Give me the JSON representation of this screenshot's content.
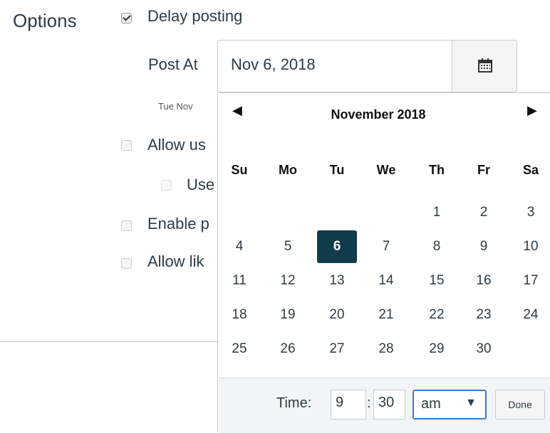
{
  "options": {
    "label": "Options",
    "delay_posting": {
      "label": "Delay posting",
      "checked": true
    },
    "post_at_label": "Post At",
    "post_at_value": "Nov 6, 2018",
    "post_at_hint": "Tue Nov",
    "allow_users": {
      "label": "Allow us",
      "checked": false
    },
    "users_sub": {
      "label": "Use",
      "checked": false
    },
    "enable": {
      "label": "Enable p",
      "checked": false
    },
    "allow_likes": {
      "label": "Allow lik",
      "checked": false
    }
  },
  "calendar_button": {
    "icon": "calendar-icon"
  },
  "datepicker": {
    "prev": "◀",
    "next": "▶",
    "month_year": "November 2018",
    "weekdays": [
      "Su",
      "Mo",
      "Tu",
      "We",
      "Th",
      "Fr",
      "Sa"
    ],
    "weeks": [
      [
        "",
        "",
        "",
        "",
        "1",
        "2",
        "3"
      ],
      [
        "4",
        "5",
        "6",
        "7",
        "8",
        "9",
        "10"
      ],
      [
        "11",
        "12",
        "13",
        "14",
        "15",
        "16",
        "17"
      ],
      [
        "18",
        "19",
        "20",
        "21",
        "22",
        "23",
        "24"
      ],
      [
        "25",
        "26",
        "27",
        "28",
        "29",
        "30",
        ""
      ]
    ],
    "selected_day": "6",
    "time_label": "Time:",
    "hour": "9",
    "minute": "30",
    "ampm": "am",
    "ampm_arrow": "▼",
    "done_label": "Done",
    "accent": "#0f3b4a"
  }
}
